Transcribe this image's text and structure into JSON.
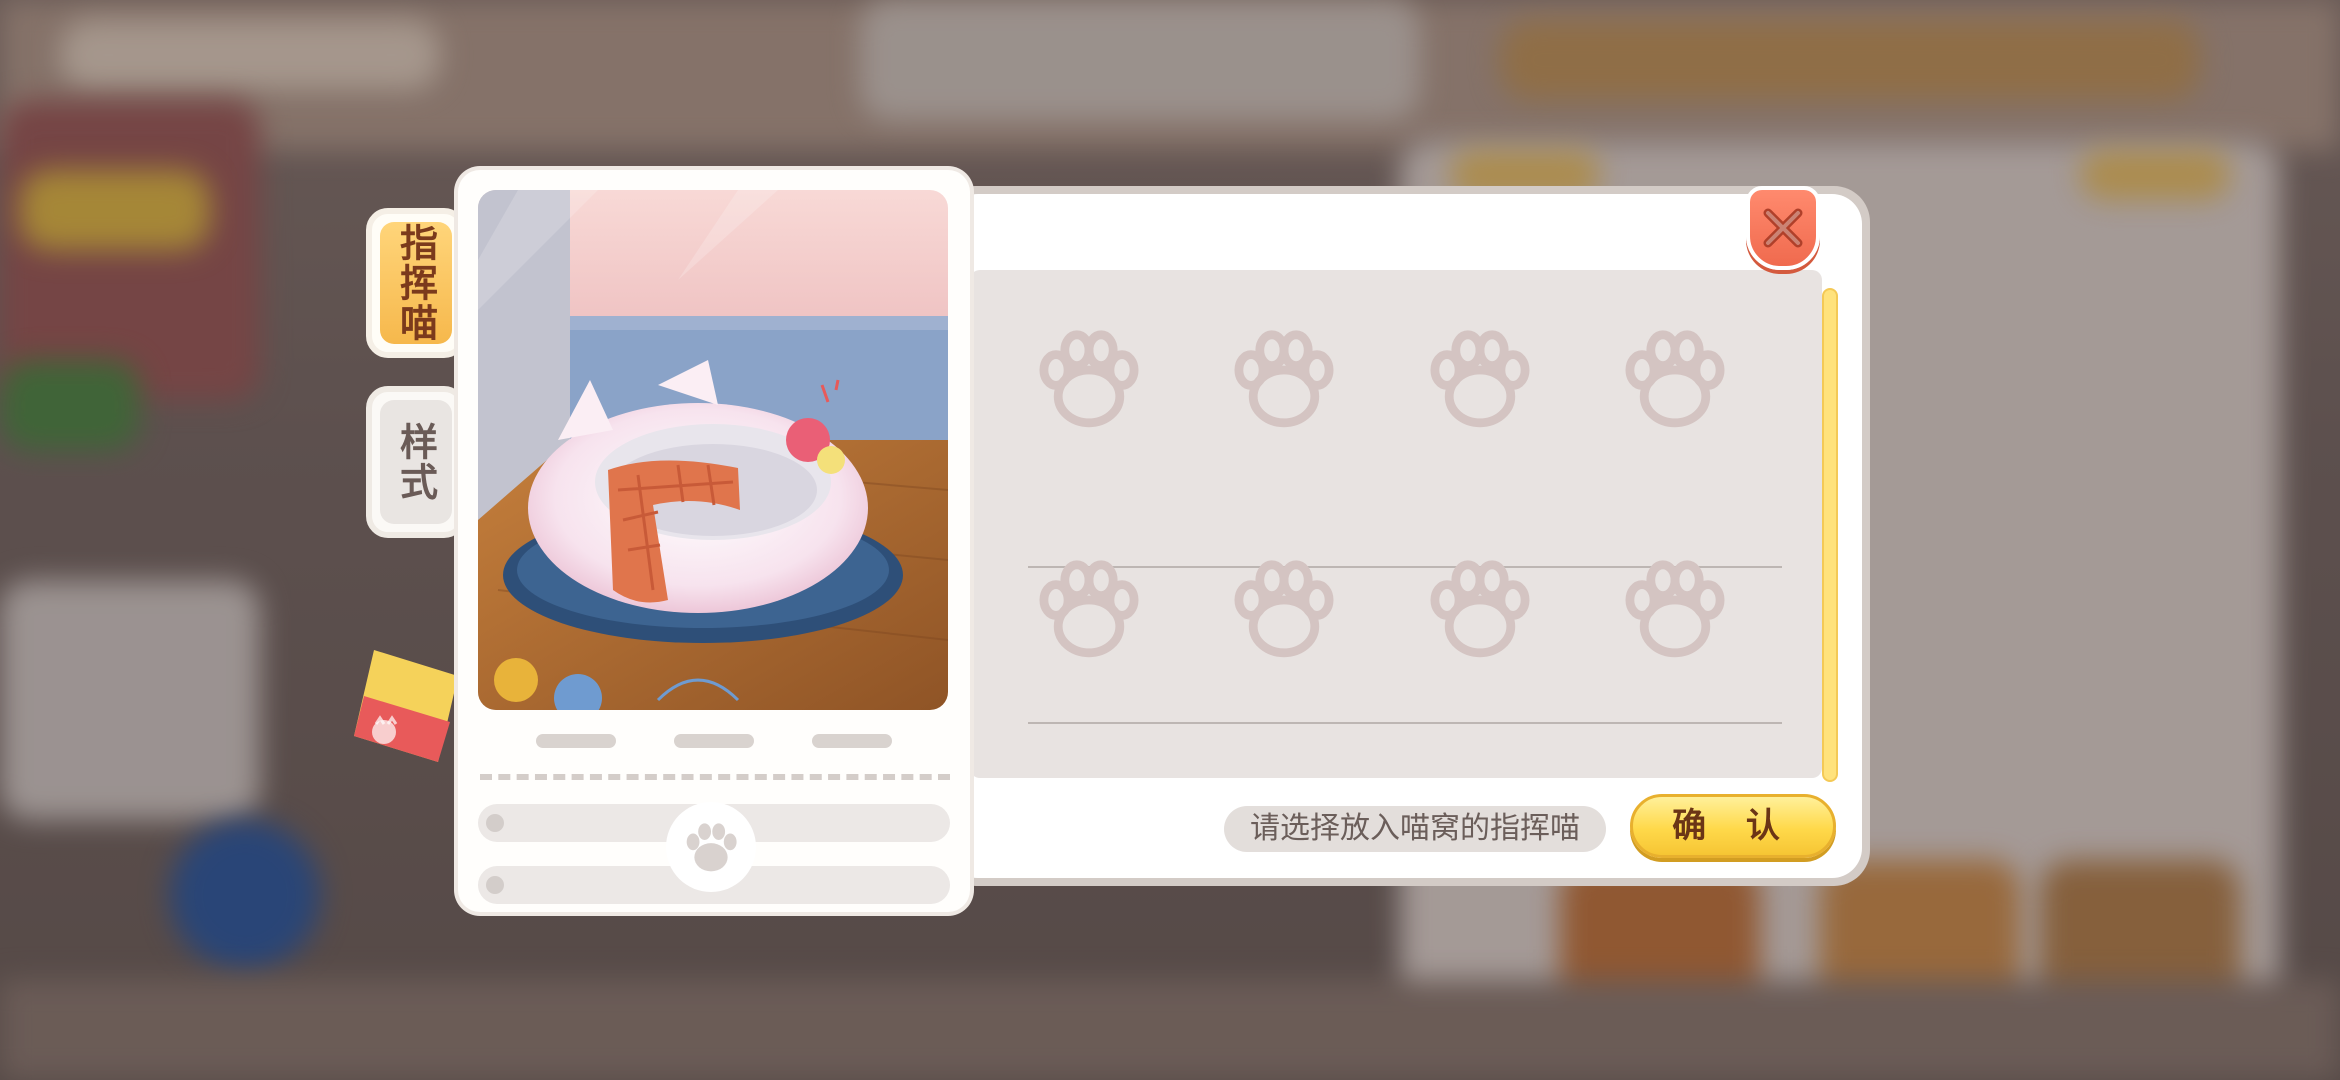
{
  "tabs": [
    {
      "label": "指挥喵",
      "active": true
    },
    {
      "label": "样式",
      "active": false
    }
  ],
  "slots": {
    "rows": 2,
    "cols": 4,
    "placeholder_icon": "paw-icon"
  },
  "footer": {
    "hint": "请选择放入喵窝的指挥喵",
    "confirm_label": "确 认"
  },
  "close_icon": "close-icon",
  "preview": {
    "page_dots": 3
  },
  "colors": {
    "accent_yellow": "#ffd94a",
    "close_red": "#f06a4e",
    "tab_active": "#f6b84c",
    "slot_bg": "#e8e3e1",
    "paw": "#d4c4c2"
  }
}
